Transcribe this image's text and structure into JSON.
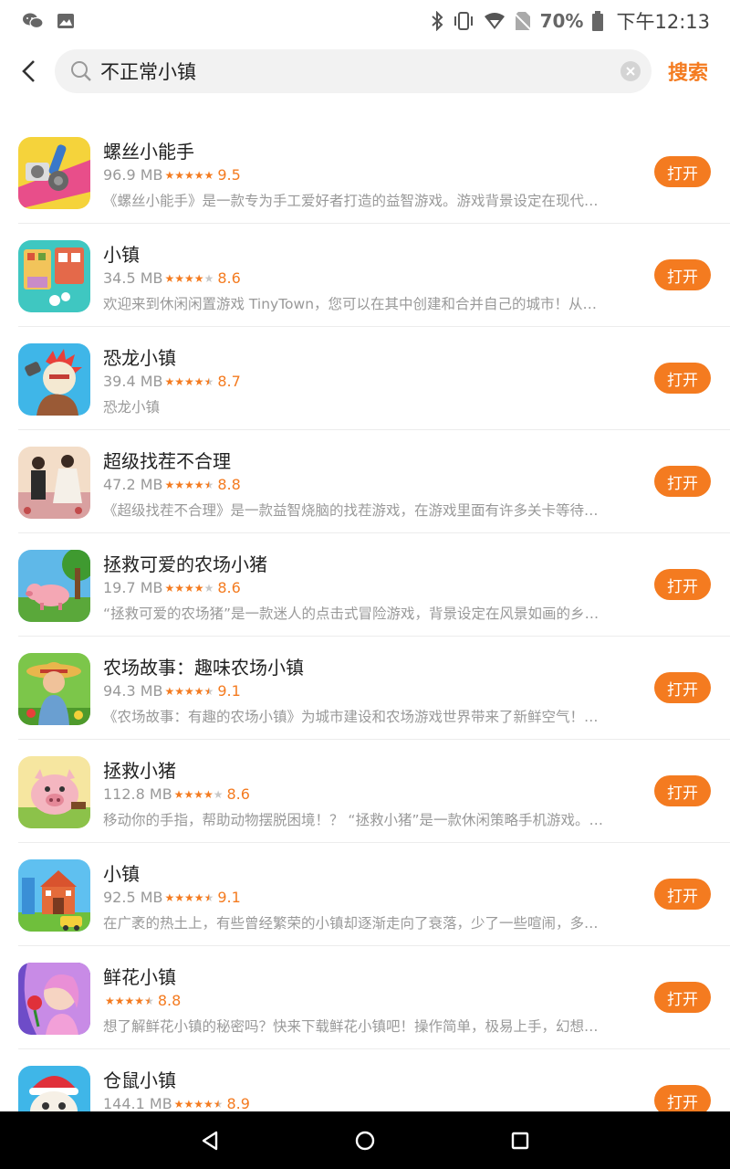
{
  "status_bar": {
    "battery_pct": "70%",
    "time": "下午12:13",
    "icons": [
      "wechat-icon",
      "gallery-icon",
      "bluetooth-icon",
      "vibrate-icon",
      "wifi-icon",
      "no-sim-icon",
      "battery-icon"
    ]
  },
  "search": {
    "query": "不正常小镇",
    "button_label": "搜索"
  },
  "colors": {
    "accent": "#f47b20",
    "text_secondary": "#999999",
    "background": "#ffffff"
  },
  "apps": [
    {
      "name": "螺丝小能手",
      "size": "96.9 MB",
      "rating": "9.5",
      "rating_value": 9.5,
      "desc": "《螺丝小能手》是一款专为手工爱好者打造的益智游戏。游戏背景设定在现代…",
      "open_label": "打开",
      "icon": "screw-game-icon"
    },
    {
      "name": "小镇",
      "size": "34.5 MB",
      "rating": "8.6",
      "rating_value": 8.6,
      "desc": "欢迎来到休闲闲置游戏 TinyTown，您可以在其中创建和合并自己的城市！从…",
      "open_label": "打开",
      "icon": "tiny-town-icon"
    },
    {
      "name": "恐龙小镇",
      "size": "39.4 MB",
      "rating": "8.7",
      "rating_value": 8.7,
      "desc": "恐龙小镇",
      "open_label": "打开",
      "icon": "dino-town-icon"
    },
    {
      "name": "超级找茬不合理",
      "size": "47.2 MB",
      "rating": "8.8",
      "rating_value": 8.8,
      "desc": "《超级找茬不合理》是一款益智烧脑的找茬游戏，在游戏里面有许多关卡等待…",
      "open_label": "打开",
      "icon": "spot-difference-icon"
    },
    {
      "name": "拯救可爱的农场小猪",
      "size": "19.7 MB",
      "rating": "8.6",
      "rating_value": 8.6,
      "desc": "“拯救可爱的农场猪”是一款迷人的点击式冒险游戏，背景设定在风景如画的乡…",
      "open_label": "打开",
      "icon": "farm-pig-icon"
    },
    {
      "name": "农场故事：趣味农场小镇",
      "size": "94.3 MB",
      "rating": "9.1",
      "rating_value": 9.1,
      "desc": "《农场故事：有趣的农场小镇》为城市建设和农场游戏世界带来了新鲜空气！…",
      "open_label": "打开",
      "icon": "farm-story-icon"
    },
    {
      "name": "拯救小猪",
      "size": "112.8 MB",
      "rating": "8.6",
      "rating_value": 8.6,
      "desc": "移动你的手指，帮助动物摆脱困境！？ “拯救小猪”是一款休闲策略手机游戏。…",
      "open_label": "打开",
      "icon": "save-pig-icon"
    },
    {
      "name": "小镇",
      "size": "92.5 MB",
      "rating": "9.1",
      "rating_value": 9.1,
      "desc": "在广袤的热土上，有些曾经繁荣的小镇却逐渐走向了衰落，少了一些喧闹，多…",
      "open_label": "打开",
      "icon": "town-building-icon"
    },
    {
      "name": "鲜花小镇",
      "size": "",
      "rating": "8.8",
      "rating_value": 8.8,
      "desc": "想了解鲜花小镇的秘密吗？快来下载鲜花小镇吧！操作简单，极易上手，幻想…",
      "open_label": "打开",
      "icon": "flower-town-icon"
    },
    {
      "name": "仓鼠小镇",
      "size": "144.1 MB",
      "rating": "8.9",
      "rating_value": 8.9,
      "desc": "",
      "open_label": "打开",
      "icon": "hamster-town-icon"
    }
  ]
}
